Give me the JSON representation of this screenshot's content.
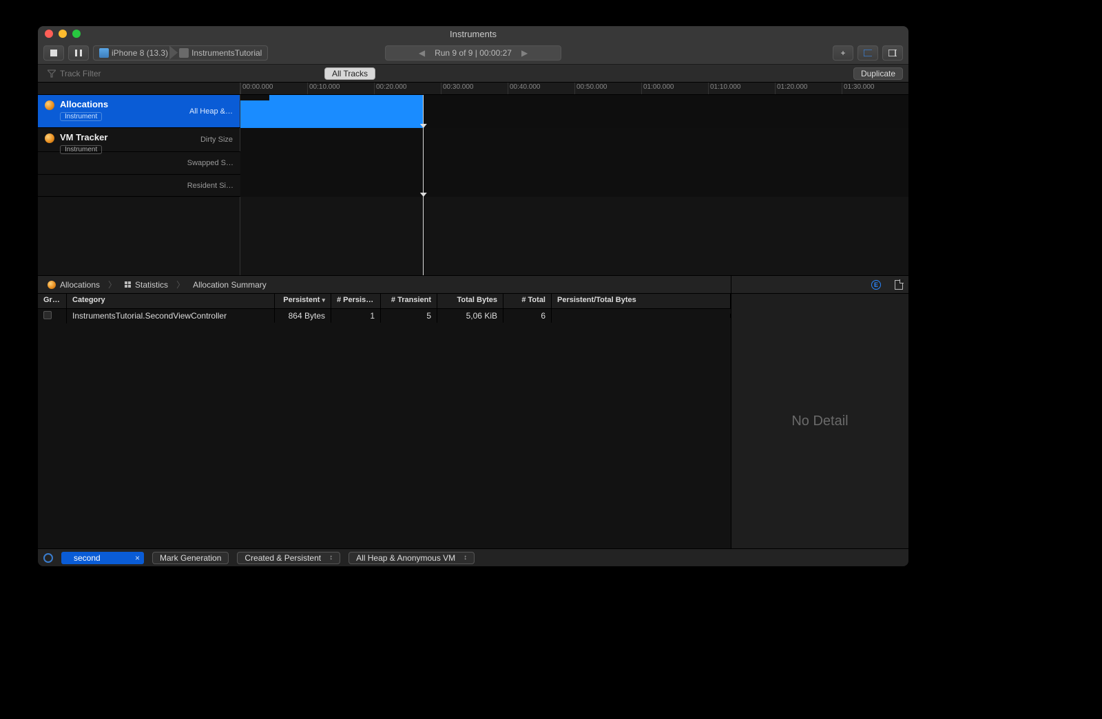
{
  "window": {
    "title": "Instruments"
  },
  "toolbar": {
    "device": "iPhone 8 (13.3)",
    "process": "InstrumentsTutorial",
    "run_prev": "◀",
    "run_next": "▶",
    "run_label": "Run 9 of 9  |  00:00:27",
    "plus": "+",
    "layout1": "▭",
    "layout2": "▯"
  },
  "filterbar": {
    "placeholder": "Track Filter",
    "all_tracks": "All Tracks",
    "duplicate": "Duplicate"
  },
  "ruler": {
    "labels": [
      "00:00.000",
      "00:10.000",
      "00:20.000",
      "00:30.000",
      "00:40.000",
      "00:50.000",
      "01:00.000",
      "01:10.000",
      "01:20.000",
      "01:30.000"
    ]
  },
  "tracks": {
    "allocations": {
      "name": "Allocations",
      "badge": "Instrument",
      "metric": "All Heap &…"
    },
    "vm": {
      "name": "VM Tracker",
      "badge": "Instrument",
      "rows": [
        "Dirty Size",
        "Swapped S…",
        "Resident Si…"
      ]
    }
  },
  "detail": {
    "bc1": "Allocations",
    "bc2": "Statistics",
    "bc3": "Allocation Summary"
  },
  "table": {
    "columns": {
      "graph": "Graph",
      "category": "Category",
      "persistent_bytes": "Persistent",
      "persistent_count": "# Persistent",
      "transient_count": "# Transient",
      "total_bytes": "Total Bytes",
      "total_count": "# Total",
      "ratio": "Persistent/Total Bytes"
    },
    "rows": [
      {
        "category": "InstrumentsTutorial.SecondViewController",
        "persistent_bytes": "864 Bytes",
        "persistent_count": "1",
        "transient_count": "5",
        "total_bytes": "5,06 KiB",
        "total_count": "6"
      }
    ]
  },
  "side": {
    "no_detail": "No Detail",
    "info": "E"
  },
  "bottom": {
    "filter_value": "second",
    "filter_x": "×",
    "mark_generation": "Mark Generation",
    "scope": "Created & Persistent",
    "heap": "All Heap & Anonymous VM"
  }
}
